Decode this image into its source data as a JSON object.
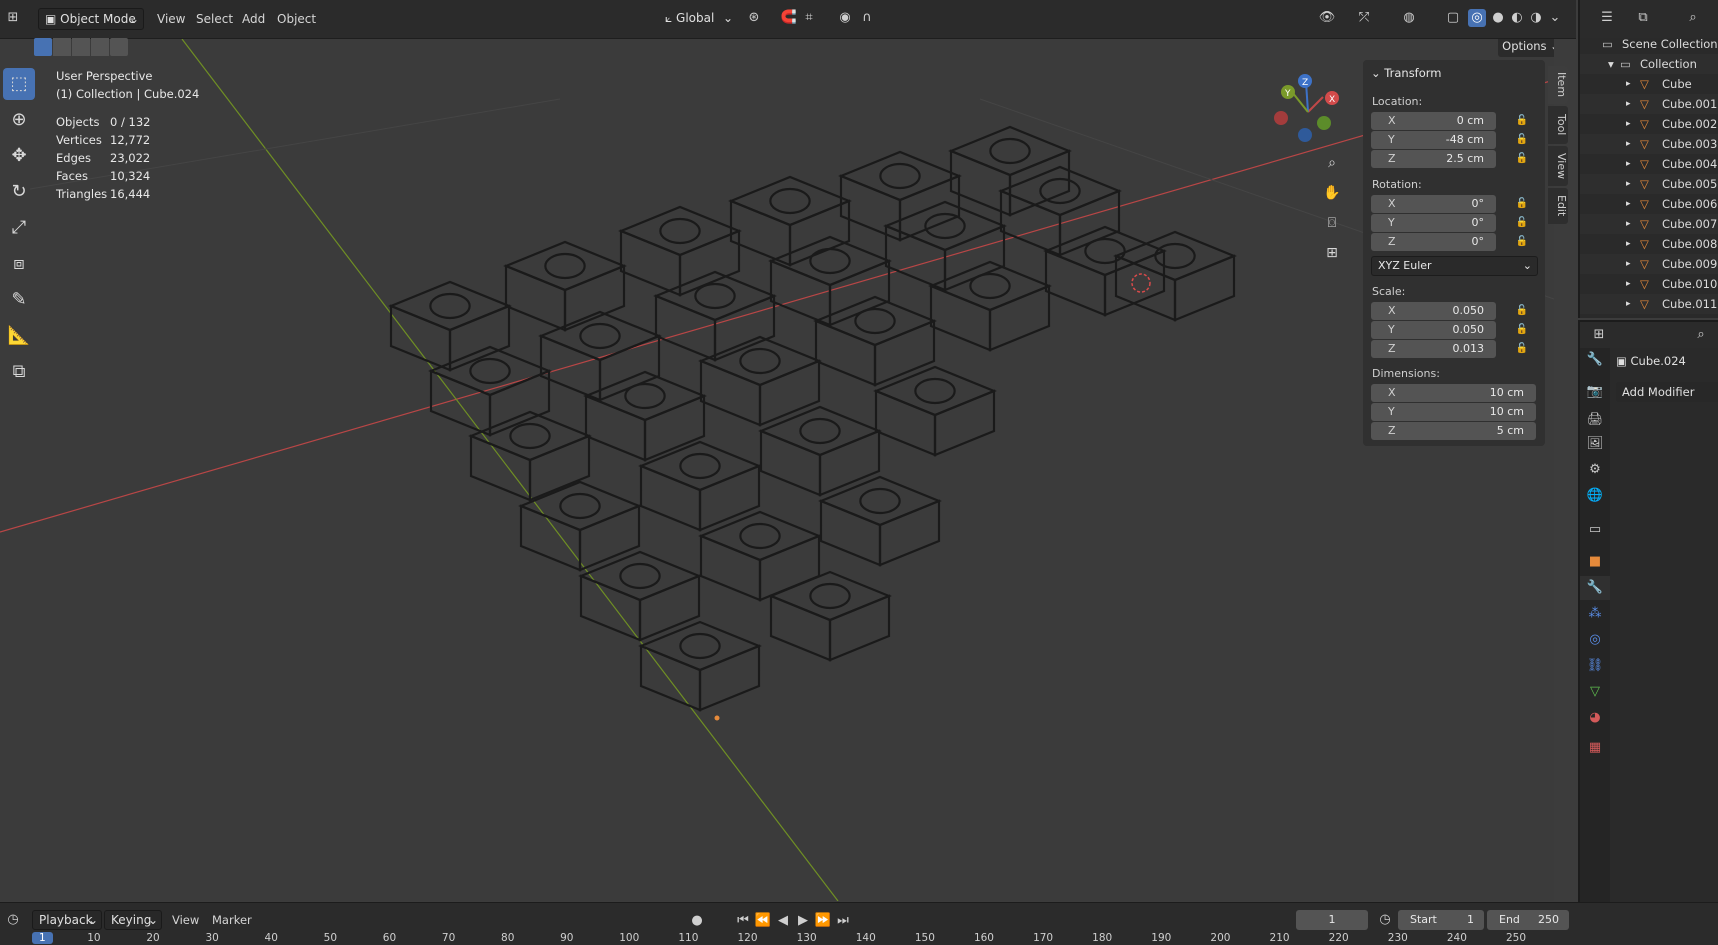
{
  "header": {
    "mode_label": "Object Mode",
    "menus": [
      "View",
      "Select",
      "Add",
      "Object"
    ],
    "transform_orientation": "Global",
    "options_label": "Options"
  },
  "viewport": {
    "view_name": "User Perspective",
    "context": "(1) Collection | Cube.024",
    "stats": [
      {
        "label": "Objects",
        "value": "0 / 132"
      },
      {
        "label": "Vertices",
        "value": "12,772"
      },
      {
        "label": "Edges",
        "value": "23,022"
      },
      {
        "label": "Faces",
        "value": "10,324"
      },
      {
        "label": "Triangles",
        "value": "16,444"
      }
    ]
  },
  "npanel": {
    "title": "Transform",
    "location_label": "Location:",
    "location": [
      {
        "axis": "X",
        "value": "0 cm"
      },
      {
        "axis": "Y",
        "value": "-48 cm"
      },
      {
        "axis": "Z",
        "value": "2.5 cm"
      }
    ],
    "rotation_label": "Rotation:",
    "rotation": [
      {
        "axis": "X",
        "value": "0°"
      },
      {
        "axis": "Y",
        "value": "0°"
      },
      {
        "axis": "Z",
        "value": "0°"
      }
    ],
    "rotation_mode": "XYZ Euler",
    "scale_label": "Scale:",
    "scale": [
      {
        "axis": "X",
        "value": "0.050"
      },
      {
        "axis": "Y",
        "value": "0.050"
      },
      {
        "axis": "Z",
        "value": "0.013"
      }
    ],
    "dimensions_label": "Dimensions:",
    "dimensions": [
      {
        "axis": "X",
        "value": "10 cm"
      },
      {
        "axis": "Y",
        "value": "10 cm"
      },
      {
        "axis": "Z",
        "value": "5 cm"
      }
    ],
    "tabs": [
      "Item",
      "Tool",
      "View",
      "Edit"
    ]
  },
  "outliner": {
    "root": "Scene Collection",
    "collection": "Collection",
    "items": [
      "Cube",
      "Cube.001",
      "Cube.002",
      "Cube.003",
      "Cube.004",
      "Cube.005",
      "Cube.006",
      "Cube.007",
      "Cube.008",
      "Cube.009",
      "Cube.010",
      "Cube.011"
    ]
  },
  "properties": {
    "object_name": "Cube.024",
    "add_modifier_label": "Add Modifier"
  },
  "timeline": {
    "menus": [
      "Playback",
      "Keying",
      "View",
      "Marker"
    ],
    "current_frame": "1",
    "start_label": "Start",
    "start_value": "1",
    "end_label": "End",
    "end_value": "250",
    "frame_numbers": [
      "1",
      "10",
      "20",
      "30",
      "40",
      "50",
      "60",
      "70",
      "80",
      "90",
      "100",
      "110",
      "120",
      "130",
      "140",
      "150",
      "160",
      "170",
      "180",
      "190",
      "200",
      "210",
      "220",
      "230",
      "240",
      "250"
    ]
  },
  "colors": {
    "accent": "#4772b3",
    "x_axis": "#c24a4a",
    "y_axis": "#7a9a2a",
    "object_icon": "#e58a3b"
  }
}
